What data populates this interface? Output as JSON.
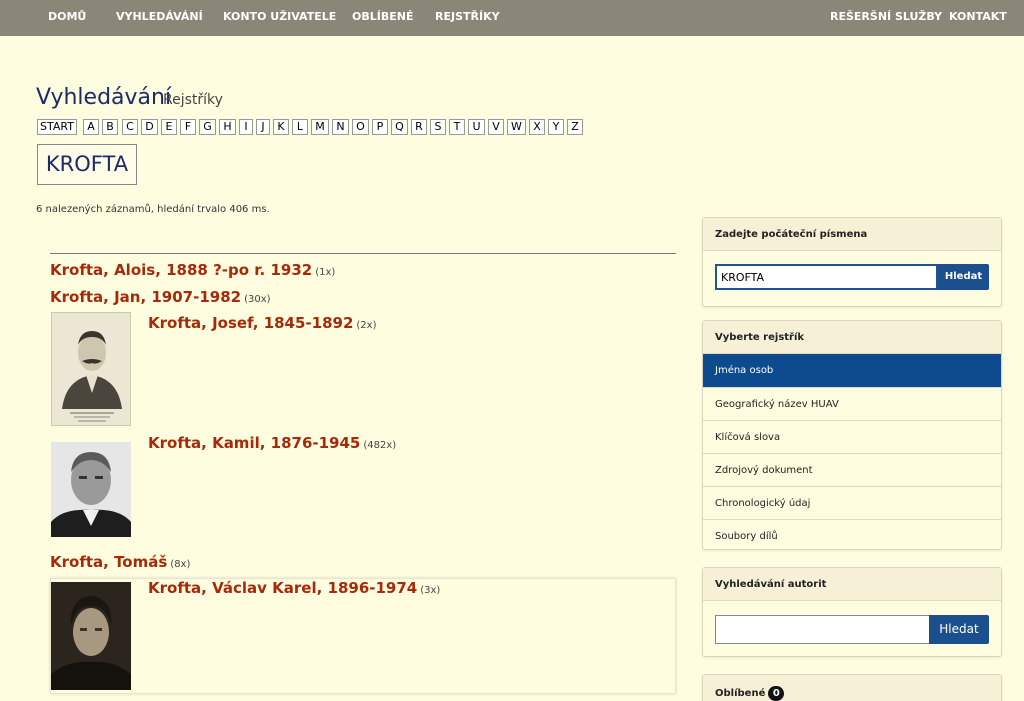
{
  "nav": {
    "left": [
      "DOMŮ",
      "VYHLEDÁVÁNÍ",
      "KONTO UŽIVATELE",
      "OBLÍBENÉ",
      "REJSTŘÍKY"
    ],
    "right": [
      "REŠERŠNÍ SLUŽBY",
      "KONTAKT"
    ]
  },
  "header": {
    "title": "Vyhledávání",
    "subtitle": "Rejstříky"
  },
  "alphabet": [
    "START",
    "A",
    "B",
    "C",
    "D",
    "E",
    "F",
    "G",
    "H",
    "I",
    "J",
    "K",
    "L",
    "M",
    "N",
    "O",
    "P",
    "Q",
    "R",
    "S",
    "T",
    "U",
    "V",
    "W",
    "X",
    "Y",
    "Z"
  ],
  "query": "KROFTA",
  "found_text": "6 nalezených záznamů, hledání trvalo 406 ms.",
  "results": [
    {
      "name": "Krofta, Alois, 1888 ?-po r. 1932",
      "count": "(1x)"
    },
    {
      "name": "Krofta, Jan, 1907-1982",
      "count": "(30x)"
    },
    {
      "name": "Krofta, Josef, 1845-1892",
      "count": "(2x)"
    },
    {
      "name": "Krofta, Kamil, 1876-1945",
      "count": "(482x)"
    },
    {
      "name": "Krofta, Tomáš",
      "count": "(8x)"
    },
    {
      "name": "Krofta, Václav Karel, 1896-1974",
      "count": "(3x)"
    }
  ],
  "panel_letters": {
    "title": "Zadejte počáteční písmena",
    "value": "KROFTA",
    "button": "Hledat"
  },
  "panel_registry": {
    "title": "Vyberte rejstřík",
    "items": [
      "Jména osob",
      "Geografický název HUAV",
      "Klíčová slova",
      "Zdrojový dokument",
      "Chronologický údaj",
      "Soubory dílů"
    ]
  },
  "panel_authority": {
    "title": "Vyhledávání autorit",
    "value": "",
    "button": "Hledat"
  },
  "panel_favorites": {
    "title": "Oblíbené",
    "count": "0"
  },
  "colors": {
    "nav_bg": "#8a8778",
    "page_bg": "#fffde0",
    "link": "#a62a0a",
    "accent_blue": "#0e4b8e"
  }
}
